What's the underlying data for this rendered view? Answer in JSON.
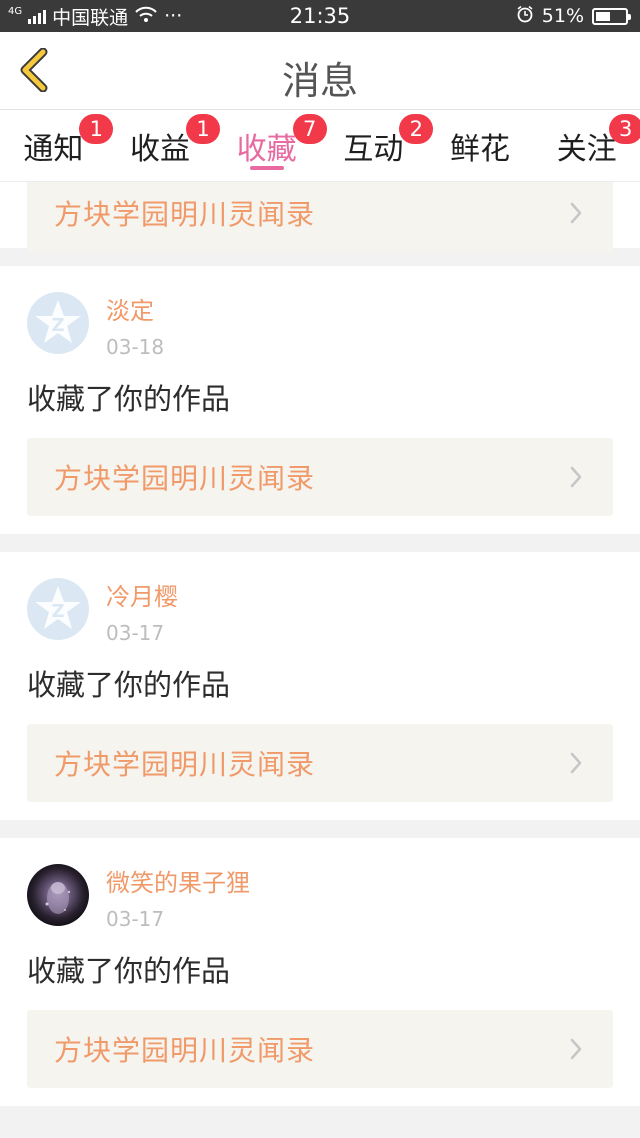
{
  "status_bar": {
    "network": "4G",
    "carrier": "中国联通",
    "more": "···",
    "time": "21:35",
    "battery_percent": "51%",
    "battery_level": 0.51
  },
  "header": {
    "title": "消息"
  },
  "tabs": [
    {
      "label": "通知",
      "badge": "1"
    },
    {
      "label": "收益",
      "badge": "1"
    },
    {
      "label": "收藏",
      "badge": "7"
    },
    {
      "label": "互动",
      "badge": "2"
    },
    {
      "label": "鲜花",
      "badge": ""
    },
    {
      "label": "关注",
      "badge": "3"
    }
  ],
  "active_tab": "收藏",
  "colors": {
    "accent_pink": "#e76aa1",
    "badge_red": "#f2394a",
    "username_orange": "#f09a6a",
    "back_arrow_yellow": "#f5c93b"
  },
  "feed": {
    "partial_item": {
      "work_title": "方块学园明川灵闻录"
    },
    "items": [
      {
        "username": "淡定",
        "date": "03-18",
        "action": "收藏了你的作品",
        "work_title": "方块学园明川灵闻录",
        "avatar": "qzone-default-avatar"
      },
      {
        "username": "冷月樱",
        "date": "03-17",
        "action": "收藏了你的作品",
        "work_title": "方块学园明川灵闻录",
        "avatar": "qzone-default-avatar"
      },
      {
        "username": "微笑的果子狸",
        "date": "03-17",
        "action": "收藏了你的作品",
        "work_title": "方块学园明川灵闻录",
        "avatar": "photo-avatar"
      }
    ]
  }
}
